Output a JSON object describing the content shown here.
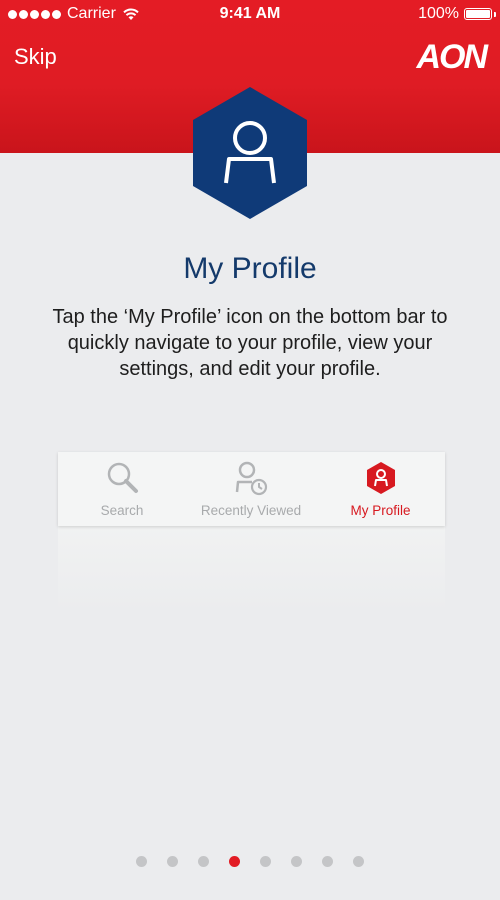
{
  "status_bar": {
    "carrier": "Carrier",
    "time": "9:41 AM",
    "battery": "100%"
  },
  "header": {
    "skip_label": "Skip",
    "logo_text": "AON"
  },
  "content": {
    "title": "My Profile",
    "description": "Tap the ‘My Profile’ icon on the bottom bar to quickly navigate to your profile, view your settings, and edit your profile."
  },
  "tabbar_preview": {
    "tabs": [
      {
        "label": "Search",
        "icon": "search-icon",
        "active": false
      },
      {
        "label": "Recently Viewed",
        "icon": "recently-viewed-icon",
        "active": false
      },
      {
        "label": "My Profile",
        "icon": "profile-icon",
        "active": true
      }
    ]
  },
  "pagination": {
    "total": 8,
    "current": 4
  },
  "colors": {
    "brand_red": "#e41c25",
    "navy": "#143a6b",
    "dot_inactive": "#c4c5c7"
  }
}
